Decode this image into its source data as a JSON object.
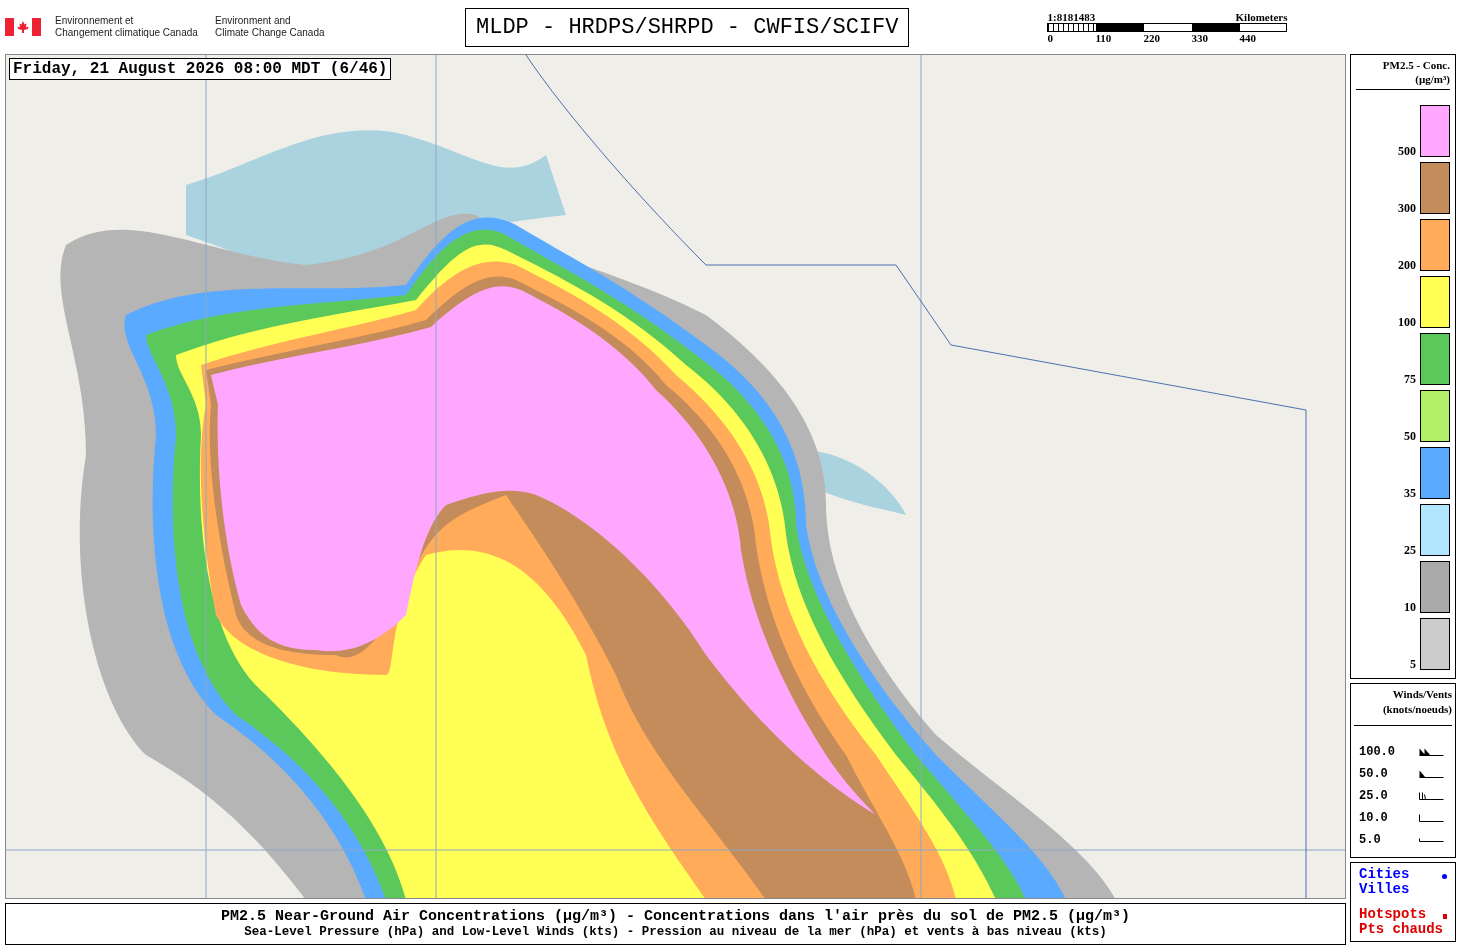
{
  "header": {
    "agency_fr": "Environnement et\nChangement climatique Canada",
    "agency_en": "Environment and\nClimate Change Canada",
    "title": "MLDP - HRDPS/SHRPD - CWFIS/SCIFV"
  },
  "scale_bar": {
    "ratio": "1:8181483",
    "unit": "Kilometers",
    "ticks": [
      "0",
      "110",
      "220",
      "330",
      "440"
    ]
  },
  "map": {
    "timestamp": "Friday, 21 August 2026 08:00 MDT (6/46)"
  },
  "concentration_legend": {
    "title": "PM2.5 - Conc.\n(µg/m³)",
    "items": [
      {
        "label": "500",
        "color": "#ffa6ff"
      },
      {
        "label": "300",
        "color": "#c48c5a"
      },
      {
        "label": "200",
        "color": "#ffab5a"
      },
      {
        "label": "100",
        "color": "#ffff55"
      },
      {
        "label": "75",
        "color": "#5ac85a"
      },
      {
        "label": "50",
        "color": "#b2f06a"
      },
      {
        "label": "35",
        "color": "#5aaaff"
      },
      {
        "label": "25",
        "color": "#b2e6ff"
      },
      {
        "label": "10",
        "color": "#aaaaaa"
      },
      {
        "label": "5",
        "color": "#cccccc"
      }
    ]
  },
  "wind_legend": {
    "title": "Winds/Vents\n(knots/noeuds)",
    "items": [
      {
        "label": "100.0",
        "kind": "pennant2"
      },
      {
        "label": "50.0",
        "kind": "pennant"
      },
      {
        "label": "25.0",
        "kind": "barbs"
      },
      {
        "label": "10.0",
        "kind": "barb"
      },
      {
        "label": "5.0",
        "kind": "half"
      }
    ]
  },
  "symbol_legend": [
    {
      "label": "Cities\nVilles",
      "kind": "dot",
      "color": "#0000ff"
    },
    {
      "label": "Hotspots\nPts chauds",
      "kind": "square",
      "color": "#dd0000"
    }
  ],
  "caption": {
    "line_1": "PM2.5 Near-Ground Air Concentrations (µg/m³) - Concentrations dans l'air près du sol de PM2.5 (µg/m³)",
    "line_2": "Sea-Level Pressure (hPa) and Low-Level Winds (kts) - Pression au niveau de la mer (hPa) et vents à bas niveau (kts)"
  }
}
